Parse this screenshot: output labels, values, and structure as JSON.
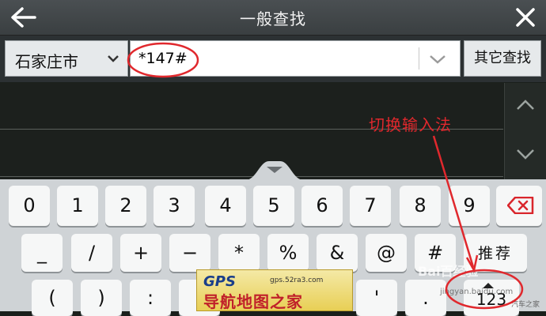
{
  "header": {
    "title": "一般查找",
    "back_icon": "back-arrow-icon",
    "close_icon": "close-icon"
  },
  "search": {
    "city": "石家庄市",
    "query": "*147#",
    "other_button": "其它查找"
  },
  "annotation": {
    "switch_input_text": "切换输入法",
    "color": "#e0282d"
  },
  "keyboard": {
    "row1": [
      "0",
      "1",
      "2",
      "3",
      "4",
      "5",
      "6",
      "7",
      "8",
      "9"
    ],
    "row2": [
      "_",
      "/",
      "+",
      "−",
      "*",
      "%",
      "&",
      "@",
      "#"
    ],
    "recommend": "推荐",
    "row3": [
      "(",
      ")",
      ":",
      ";",
      "/",
      "'",
      ".",
      "。"
    ],
    "mode_key": "123"
  },
  "watermarks": {
    "gps_logo": "GPS",
    "gps_url": "gps.52ra3.com",
    "gps_cn": "导航地图之家",
    "baidu": "Bai百经验",
    "baidu_url": "jingyan.baidu.com",
    "corner": "汽车之家"
  },
  "colors": {
    "titlebar": "#3f4446",
    "keyboard_bg": "#cfd3d6",
    "key_bg": "#f6f7f7",
    "backspace": "#d9262c"
  }
}
